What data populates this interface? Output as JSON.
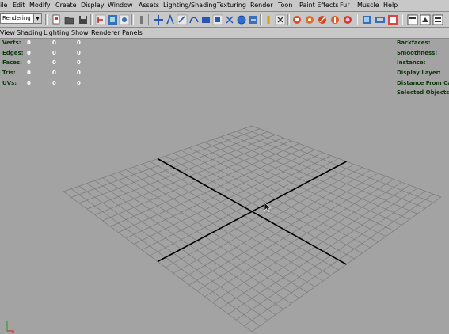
{
  "menu": [
    "ile",
    "Edit",
    "Modify",
    "Create",
    "Display",
    "Window",
    "Assets",
    "Lighting/Shading",
    "Texturing",
    "Render",
    "Toon",
    "Paint Effects",
    "Fur",
    "Muscle",
    "Help"
  ],
  "toolbar": {
    "menu_set": "Rendering",
    "icons": [
      "new-scene-icon",
      "open-scene-icon",
      "save-scene-icon",
      "select-by-hierarchy-icon",
      "select-by-object-icon",
      "select-by-component-icon",
      "lock-selection-icon",
      "snap-to-grid-icon",
      "snap-to-curve-icon",
      "snap-to-point-icon",
      "snap-to-plane-icon",
      "history-icon",
      "render-frame-icon",
      "ipr-render-icon",
      "render-settings-icon",
      "hypershade-icon"
    ]
  },
  "panel_menu": [
    "View",
    "Shading",
    "Lighting",
    "Show",
    "Renderer",
    "Panels"
  ],
  "hud_left": [
    {
      "label": "Verts:",
      "values": [
        "0",
        "0",
        "0"
      ]
    },
    {
      "label": "Edges:",
      "values": [
        "0",
        "0",
        "0"
      ]
    },
    {
      "label": "Faces:",
      "values": [
        "0",
        "0",
        "0"
      ]
    },
    {
      "label": "Tris:",
      "values": [
        "0",
        "0",
        "0"
      ]
    },
    {
      "label": "UVs:",
      "values": [
        "0",
        "0",
        "0"
      ]
    }
  ],
  "hud_right": [
    "Backfaces:",
    "Smoothness:",
    "Instance:",
    "Display Layer:",
    "Distance From Cam",
    "Selected Objects:"
  ],
  "axis": {
    "y": "y",
    "x": "x"
  },
  "colors": {
    "background": "#a3a3a3",
    "menu": "#c8c8c8",
    "grid": "#7a7a7a",
    "axis_lines": "#000000",
    "hud_label": "#0b3a0b"
  }
}
